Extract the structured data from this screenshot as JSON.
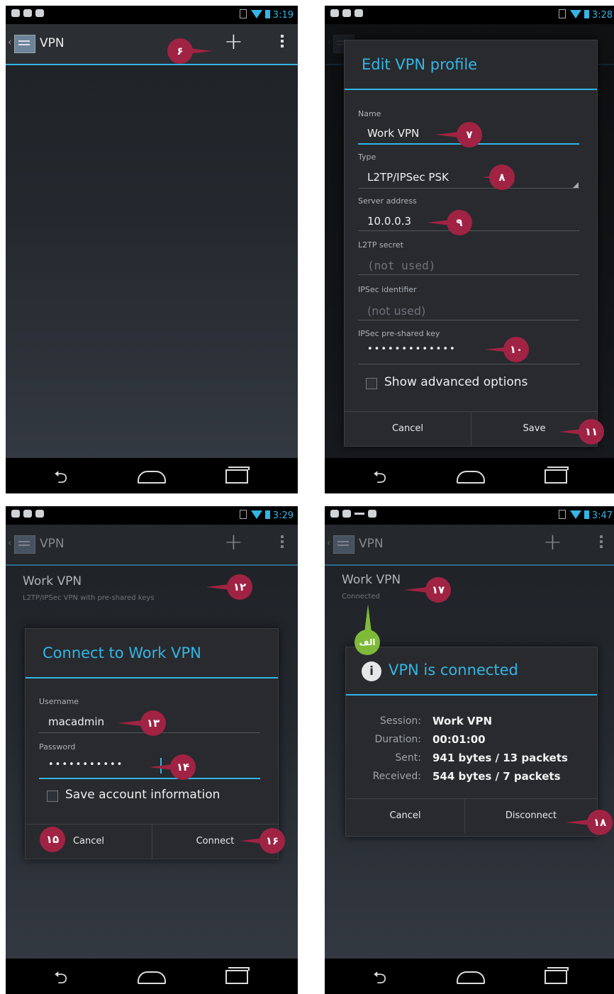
{
  "panel1": {
    "status_time": "3:19",
    "title": "VPN",
    "marker": "۶"
  },
  "panel2": {
    "status_time": "3:28",
    "dialog_title": "Edit VPN profile",
    "fields": [
      {
        "label": "Name",
        "value": "Work VPN",
        "marker": "۷"
      },
      {
        "label": "Type",
        "value": "L2TP/IPSec PSK",
        "marker": "۸"
      },
      {
        "label": "Server address",
        "value": "10.0.0.3",
        "marker": "۹"
      },
      {
        "label": "L2TP secret",
        "value": "(not used)"
      },
      {
        "label": "IPSec identifier",
        "value": "(not used)"
      },
      {
        "label": "IPSec pre-shared key",
        "value": "•••••••••••••",
        "marker": "۱۰"
      }
    ],
    "checkbox_label": "Show advanced options",
    "cancel_label": "Cancel",
    "save_label": "Save",
    "save_marker": "۱۱"
  },
  "panel3": {
    "status_time": "3:29",
    "title": "VPN",
    "list_title": "Work VPN",
    "list_subtitle": "L2TP/IPSec VPN with pre-shared keys",
    "list_marker": "۱۲",
    "dialog_title": "Connect to Work VPN",
    "username_label": "Username",
    "username_value": "macadmin",
    "username_marker": "۱۳",
    "password_label": "Password",
    "password_value": "•••••••••••",
    "password_marker": "۱۴",
    "checkbox_label": "Save account information",
    "checkbox_marker": "۱۵",
    "cancel_label": "Cancel",
    "connect_label": "Connect",
    "connect_marker": "۱۶"
  },
  "panel4": {
    "status_time": "3:47",
    "title": "VPN",
    "list_title": "Work VPN",
    "list_subtitle": "Connected",
    "list_marker": "۱۷",
    "green_marker": "الف",
    "dialog_title": "VPN is connected",
    "stats": [
      {
        "label": "Session:",
        "value": "Work VPN"
      },
      {
        "label": "Duration:",
        "value": "00:01:00"
      },
      {
        "label": "Sent:",
        "value": "941 bytes / 13 packets"
      },
      {
        "label": "Received:",
        "value": "544 bytes / 7 packets"
      }
    ],
    "cancel_label": "Cancel",
    "disconnect_label": "Disconnect",
    "disconnect_marker": "۱۸"
  },
  "colors": {
    "accent": "#33b5e5",
    "marker": "#a02343",
    "marker_green": "#7fb93a"
  }
}
